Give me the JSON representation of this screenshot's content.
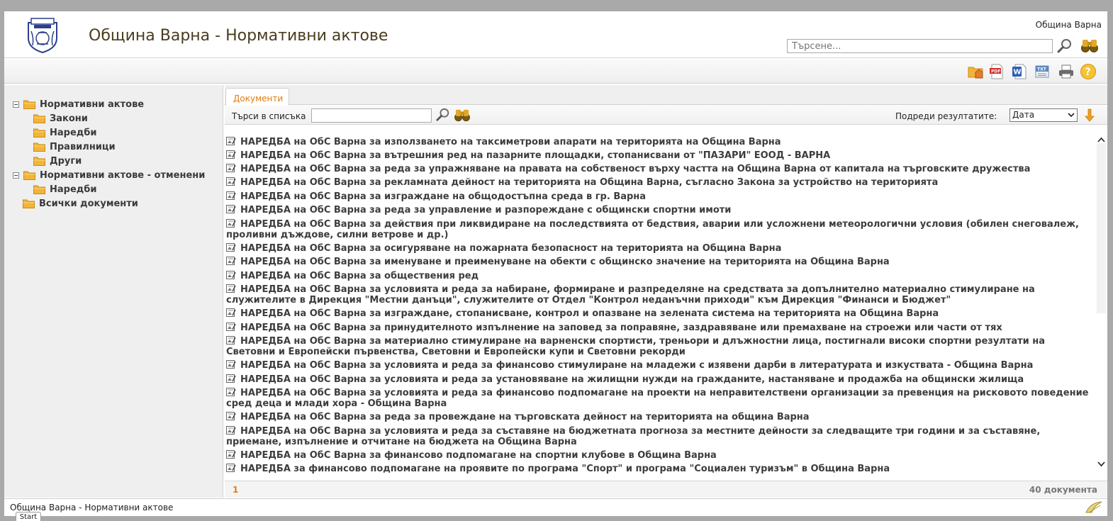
{
  "header": {
    "title": "Община Варна - Нормативни актове",
    "org_name": "Община Варна",
    "search_placeholder": "Търсене..."
  },
  "toolbar": {
    "icons": [
      "folder-home-icon",
      "pdf-export-icon",
      "word-export-icon",
      "txt-export-icon",
      "print-icon",
      "help-icon"
    ]
  },
  "sidebar": {
    "items": [
      {
        "label": "Нормативни актове",
        "level": 0,
        "expanded": true
      },
      {
        "label": "Закони",
        "level": 1
      },
      {
        "label": "Наредби",
        "level": 1
      },
      {
        "label": "Правилници",
        "level": 1
      },
      {
        "label": "Други",
        "level": 1
      },
      {
        "label": "Нормативни актове - отменени",
        "level": 0,
        "expanded": true
      },
      {
        "label": "Наредби",
        "level": 1
      },
      {
        "label": "Всички документи",
        "level": 0
      }
    ]
  },
  "main": {
    "tab_label": "Документи",
    "search_label": "Търси в списъка",
    "sort_label": "Подреди резултатите:",
    "sort_value": "Дата",
    "documents": [
      "НАРЕДБА на ОбС Варна за използването на таксиметрови апарати на територията на Община Варна",
      "НАРЕДБА на ОбС Варна за вътрешния ред на пазарните площадки, стопанисвани от \"ПАЗАРИ\" ЕООД - ВАРНА",
      "НАРЕДБА на ОбС Варна за реда за упражняване на правата на собственост върху частта на Община Варна от капитала на търговските дружества",
      "НАРЕДБА на ОбС Варна за рекламната дейност на територията на Община Варна, съгласно Закона за устройство на територията",
      "НАРЕДБА на ОбС Варна за изграждане на общодостъпна среда в гр. Варна",
      "НАРЕДБА на ОбС Варна за реда за управление и разпореждане с общински спортни имоти",
      "НАРЕДБА на ОбС Варна за действия при ликвидиране на последствията от бедствия, аварии или усложнени метеорологични условия (обилен снеговалеж, проливни дъждове, силни ветрове и др.)",
      "НАРЕДБА на ОбС Варна за осигуряване на пожарната безопасност на територията на Община Варна",
      "НАРЕДБА на ОбС Варна за именуване и преименуване на обекти с общинско значение на територията на Община Варна",
      "НАРЕДБА на ОбС Варна за обществения ред",
      "НАРЕДБА на ОбС Варна за условията и реда за набиране, формиране и разпределяне на средствата за допълнително материално стимулиране на служителите в Дирекция \"Местни данъци\", служителите от Отдел \"Контрол неданъчни приходи\" към Дирекция \"Финанси и Бюджет\"",
      "НАРЕДБА на ОбС Варна за изграждане, стопанисване, контрол и опазване на зелената система на територията на Община Варна",
      "НАРЕДБА на ОбС Варна за принудителното изпълнение на заповед за поправяне, заздравяване или премахване на строежи или части от тях",
      "НАРЕДБА на ОбС Варна за материално стимулиране на варненски спортисти, треньори и длъжностни лица, постигнали високи спортни резултати на Световни и Европейски първенства, Световни и Европейски купи и Световни рекорди",
      "НАРЕДБА на ОбС Варна за условията и реда за финансово стимулиране на младежи с изявени дарби в литературата и изкуствата - Община Варна",
      "НАРЕДБА на ОбС Варна за условията и реда за установяване на жилищни нужди на гражданите, настаняване и продажба на общински жилища",
      "НАРЕДБА на ОбС Варна за условията и реда за финансово подпомагане на проекти на неправителствени организации за превенция на рисковото поведение сред деца и млади хора - Община Варна",
      "НАРЕДБА на ОбС Варна за реда за провеждане на търговската дейност на територията на община Варна",
      "НАРЕДБА на ОбС Варна за условията и реда за съставяне на бюджетната прогноза за местните дейности за следващите три години и за съставяне, приемане, изпълнение и отчитане на бюджета на Община Варна",
      "НАРЕДБА на ОбС Варна за финансово подпомагане на спортни клубове в Община Варна",
      "НАРЕДБА за финансово подпомагане на проявите по програма \"Спорт\" и програма \"Социален туризъм\" в Община Варна"
    ],
    "page": "1",
    "count": "40 документа"
  },
  "statusbar": {
    "text": "Община Варна - Нормативни актове",
    "start_label": "Start"
  },
  "colors": {
    "accent": "#e07d10",
    "title": "#4a3c1e",
    "folder": "#f3b43a"
  }
}
